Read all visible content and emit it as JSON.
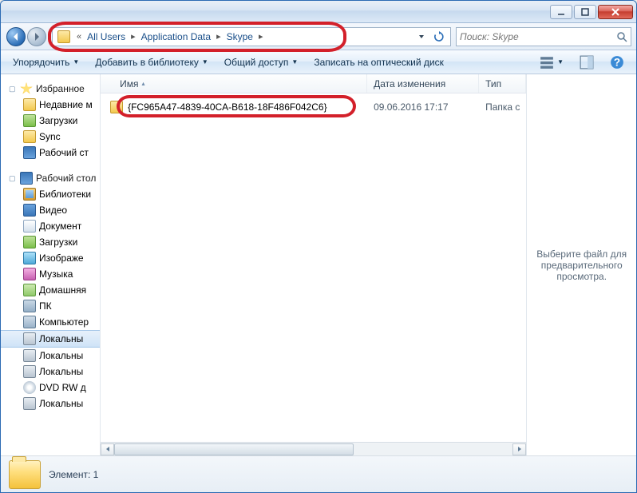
{
  "titlebar": {},
  "address": {
    "overflow_glyph": "«",
    "crumbs": [
      "All Users",
      "Application Data",
      "Skype"
    ],
    "sep": "▸"
  },
  "search": {
    "placeholder": "Поиск: Skype"
  },
  "toolbar": {
    "organize": "Упорядочить",
    "add_to_library": "Добавить в библиотеку",
    "share": "Общий доступ",
    "burn": "Записать на оптический диск"
  },
  "columns": {
    "name": "Имя",
    "date": "Дата изменения",
    "type": "Тип"
  },
  "files": [
    {
      "name": "{FC965A47-4839-40CA-B618-18F486F042C6}",
      "date": "09.06.2016 17:17",
      "type": "Папка с"
    }
  ],
  "nav": {
    "favorites": {
      "label": "Избранное",
      "items": [
        {
          "label": "Недавние м",
          "icon": "ic-folder"
        },
        {
          "label": "Загрузки",
          "icon": "ic-dl"
        },
        {
          "label": "Sync",
          "icon": "ic-sync"
        },
        {
          "label": "Рабочий ст",
          "icon": "ic-desktop"
        }
      ]
    },
    "desktop": {
      "label": "Рабочий стол",
      "items": [
        {
          "label": "Библиотеки",
          "icon": "ic-lib"
        },
        {
          "label": "Видео",
          "icon": "ic-video"
        },
        {
          "label": "Документ",
          "icon": "ic-doc"
        },
        {
          "label": "Загрузки",
          "icon": "ic-dl"
        },
        {
          "label": "Изображе",
          "icon": "ic-img"
        },
        {
          "label": "Музыка",
          "icon": "ic-music"
        },
        {
          "label": "Домашняя",
          "icon": "ic-home"
        },
        {
          "label": "ПК",
          "icon": "ic-pc"
        },
        {
          "label": "Компьютер",
          "icon": "ic-comp"
        },
        {
          "label": "Локальны",
          "icon": "ic-drive",
          "selected": true
        },
        {
          "label": "Локальны",
          "icon": "ic-drive"
        },
        {
          "label": "Локальны",
          "icon": "ic-drive"
        },
        {
          "label": "DVD RW д",
          "icon": "ic-dvd"
        },
        {
          "label": "Локальны",
          "icon": "ic-drive"
        }
      ]
    }
  },
  "preview": {
    "text": "Выберите файл для предварительного просмотра."
  },
  "status": {
    "text": "Элемент: 1"
  }
}
